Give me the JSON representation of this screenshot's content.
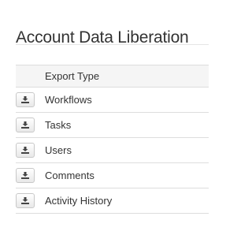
{
  "page": {
    "title": "Account Data Liberation"
  },
  "table": {
    "header": {
      "icon_column": "",
      "type_column": "Export Type"
    },
    "rows": [
      {
        "label": "Workflows",
        "icon": "download-icon"
      },
      {
        "label": "Tasks",
        "icon": "download-icon"
      },
      {
        "label": "Users",
        "icon": "download-icon"
      },
      {
        "label": "Comments",
        "icon": "download-icon"
      },
      {
        "label": "Activity History",
        "icon": "download-icon"
      }
    ]
  },
  "colors": {
    "text": "#333333",
    "header_background": "#f5f5f5",
    "row_border": "#dddddd"
  }
}
